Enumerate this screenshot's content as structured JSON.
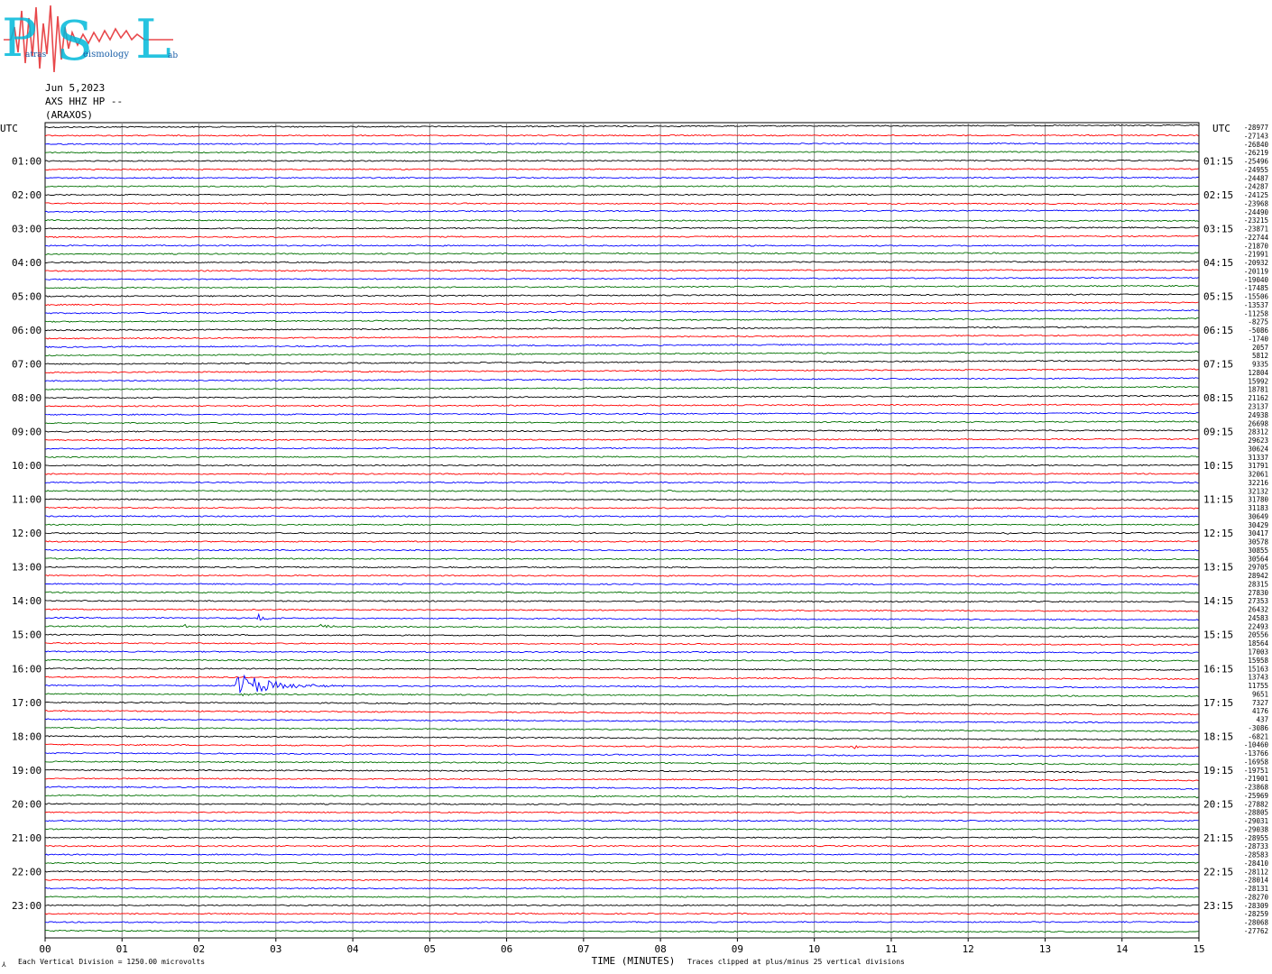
{
  "logo": {
    "big_letters": [
      "P",
      "S",
      "L"
    ],
    "small_words": [
      "atras",
      "eismology",
      "ab"
    ],
    "colors": {
      "cyan": "#00b8d9",
      "red": "#e8484b"
    }
  },
  "header": {
    "date": "Jun 5,2023",
    "channel": "AXS HHZ HP --",
    "station": "(ARAXOS)"
  },
  "footer": {
    "scale_note": "Each Vertical Division = 1250.00 microvolts",
    "clip_note": "Traces clipped at plus/minus 25 vertical divisions",
    "corner_mark": "⅄"
  },
  "chart_data": {
    "type": "line",
    "title": "",
    "xlabel": "TIME (MINUTES)",
    "ylabel": "UTC",
    "right_ylabel": "UTC",
    "xlim": [
      0,
      15
    ],
    "x_ticks": [
      "00",
      "01",
      "02",
      "03",
      "04",
      "05",
      "06",
      "07",
      "08",
      "09",
      "10",
      "11",
      "12",
      "13",
      "14",
      "15"
    ],
    "left_hour_labels": [
      "01:00",
      "02:00",
      "03:00",
      "04:00",
      "05:00",
      "06:00",
      "07:00",
      "08:00",
      "09:00",
      "10:00",
      "11:00",
      "12:00",
      "13:00",
      "14:00",
      "15:00",
      "16:00",
      "17:00",
      "18:00",
      "19:00",
      "20:00",
      "21:00",
      "22:00",
      "23:00"
    ],
    "right_hour_labels": [
      "01:15",
      "02:15",
      "03:15",
      "04:15",
      "05:15",
      "06:15",
      "07:15",
      "08:15",
      "09:15",
      "10:15",
      "11:15",
      "12:15",
      "13:15",
      "14:15",
      "15:15",
      "16:15",
      "17:15",
      "18:15",
      "19:15",
      "20:15",
      "21:15",
      "22:15",
      "23:15"
    ],
    "trace_colors": [
      "#000000",
      "#ff0000",
      "#0000ff",
      "#007000"
    ],
    "trace_offsets": [
      -28977,
      -27143,
      -26840,
      -26219,
      -25496,
      -24955,
      -24487,
      -24287,
      -24125,
      -23968,
      -24490,
      -23215,
      -23871,
      -22744,
      -21870,
      -21991,
      -20932,
      -20119,
      -19040,
      -17485,
      -15506,
      -13537,
      -11258,
      -8275,
      -5086,
      -1740,
      2057,
      5812,
      9335,
      12804,
      15992,
      18781,
      21162,
      23137,
      24938,
      26698,
      28312,
      29623,
      30624,
      31337,
      31791,
      32061,
      32216,
      32132,
      31780,
      31183,
      30649,
      30429,
      30417,
      30578,
      30855,
      30564,
      29705,
      28942,
      28315,
      27830,
      27353,
      26432,
      24583,
      22493,
      20556,
      18564,
      17003,
      15958,
      15163,
      13743,
      11755,
      9651,
      7327,
      4176,
      437,
      -3086,
      -6821,
      -10460,
      -13766,
      -16958,
      -19751,
      -21901,
      -23868,
      -25969,
      -27882,
      -28805,
      -29031,
      -29038,
      -28955,
      -28733,
      -28583,
      -28410,
      -28112,
      -28014,
      -28131,
      -28270,
      -28309,
      -28259,
      -28068,
      -27762
    ],
    "events": [
      {
        "trace": 58,
        "minute": 2.75,
        "duration": 0.45,
        "amplitude": 6
      },
      {
        "trace": 59,
        "minute": 1.8,
        "duration": 0.18,
        "amplitude": 5
      },
      {
        "trace": 59,
        "minute": 3.55,
        "duration": 0.5,
        "amplitude": 5
      },
      {
        "trace": 66,
        "minute": 2.45,
        "duration": 1.6,
        "amplitude": 17
      },
      {
        "trace": 67,
        "minute": 2.55,
        "duration": 0.4,
        "amplitude": 4
      },
      {
        "trace": 22,
        "minute": 10.6,
        "duration": 0.15,
        "amplitude": 3
      },
      {
        "trace": 23,
        "minute": 7.5,
        "duration": 0.15,
        "amplitude": 3
      },
      {
        "trace": 36,
        "minute": 10.8,
        "duration": 0.15,
        "amplitude": 3
      },
      {
        "trace": 43,
        "minute": 8.1,
        "duration": 0.12,
        "amplitude": 3
      },
      {
        "trace": 43,
        "minute": 10.95,
        "duration": 0.12,
        "amplitude": 3
      },
      {
        "trace": 48,
        "minute": 12.5,
        "duration": 0.1,
        "amplitude": 4
      },
      {
        "trace": 73,
        "minute": 10.5,
        "duration": 0.3,
        "amplitude": 3
      },
      {
        "trace": 91,
        "minute": 3.7,
        "duration": 0.1,
        "amplitude": 3
      }
    ]
  }
}
